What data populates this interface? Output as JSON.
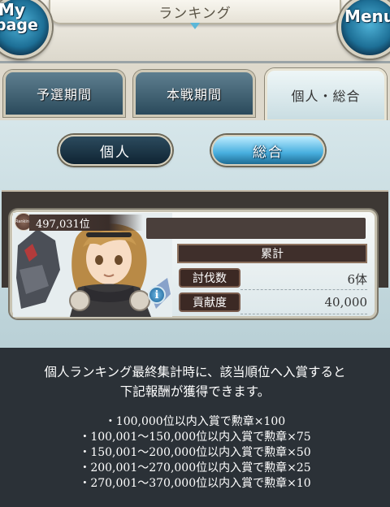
{
  "header": {
    "title": "ランキング",
    "mypage_label_1": "My",
    "mypage_label_2": "page",
    "menu_label": "Menu"
  },
  "tabs": [
    {
      "label": "予選期間",
      "active": false
    },
    {
      "label": "本戦期間",
      "active": false
    },
    {
      "label": "個人・総合",
      "active": true
    }
  ],
  "sub_tabs": [
    {
      "label": "個人",
      "active": false
    },
    {
      "label": "総合",
      "active": true
    }
  ],
  "player": {
    "rank_badge": "Ranking",
    "rank": "497,031位",
    "total_label": "累計",
    "stats": [
      {
        "label": "討伐数",
        "value": "6体"
      },
      {
        "label": "貢献度",
        "value": "40,000"
      }
    ]
  },
  "description": {
    "line1": "個人ランキング最終集計時に、該当順位へ入賞すると",
    "line2": "下記報酬が獲得できます。"
  },
  "rewards": [
    "・100,000位以内入賞で勲章×100",
    "・100,001～150,000位以内入賞で勲章×75",
    "・150,001～200,000位以内入賞で勲章×50",
    "・200,001～270,000位以内入賞で勲章×25",
    "・270,001～370,000位以内入賞で勲章×10"
  ],
  "colors": {
    "accent_blue": "#47aede",
    "panel_bg": "#c9dde2",
    "dark_bg": "#2b3137",
    "label_brown": "#3c2924"
  }
}
